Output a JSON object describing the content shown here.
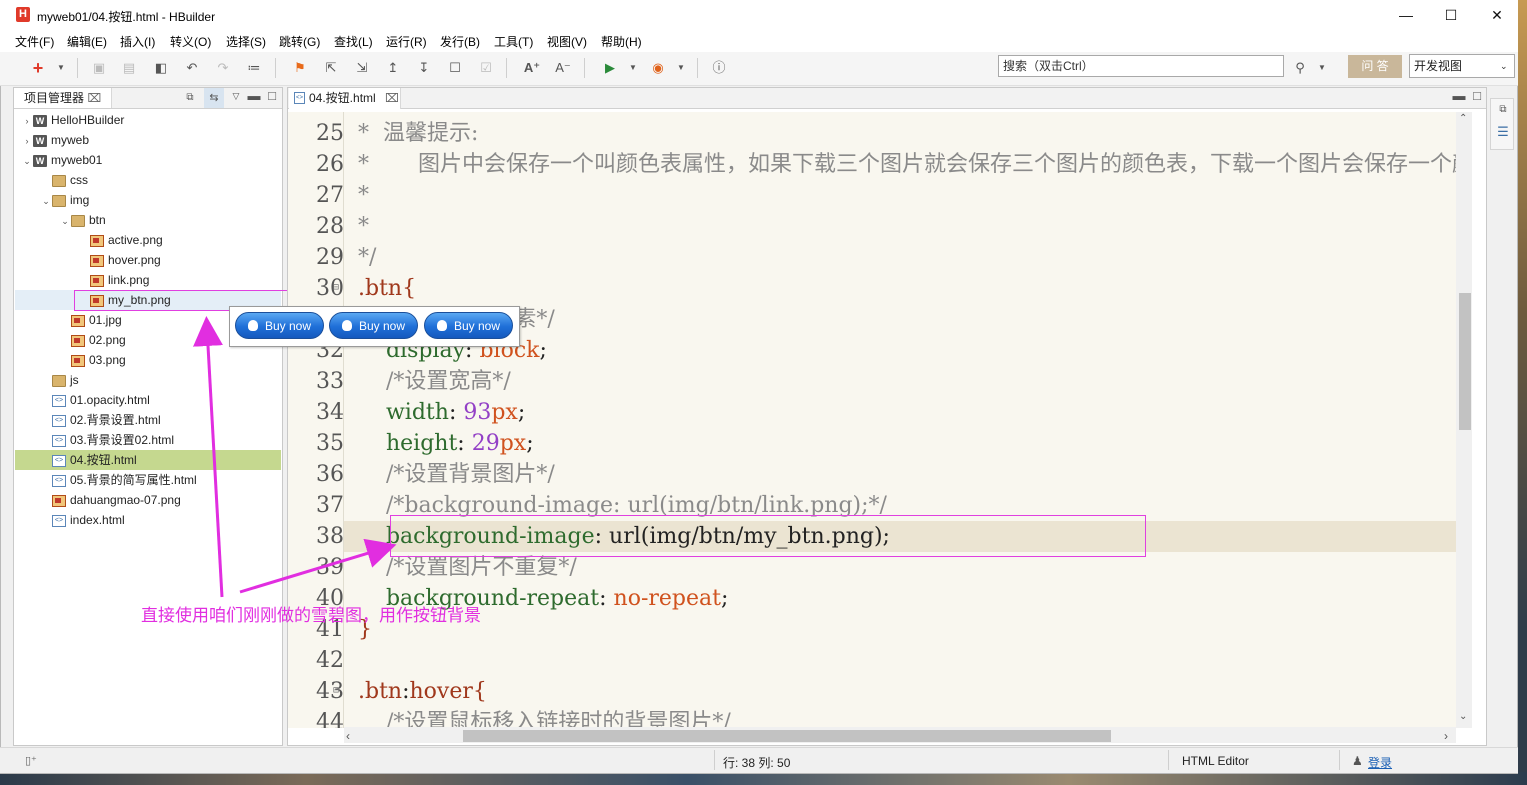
{
  "window": {
    "title": "myweb01/04.按钮.html  -  HBuilder",
    "app_icon": "H"
  },
  "menu": [
    "文件(F)",
    "编辑(E)",
    "插入(I)",
    "转义(O)",
    "选择(S)",
    "跳转(G)",
    "查找(L)",
    "运行(R)",
    "发行(B)",
    "工具(T)",
    "视图(V)",
    "帮助(H)"
  ],
  "toolbar": {
    "search_placeholder": "搜索（双击Ctrl）",
    "qa_label": "问 答",
    "view_select": "开发视图"
  },
  "project_panel": {
    "tab_label": "项目管理器",
    "tree": [
      {
        "label": "HelloHBuilder",
        "type": "project",
        "depth": 0,
        "toggle": "›"
      },
      {
        "label": "myweb",
        "type": "project",
        "depth": 0,
        "toggle": "›"
      },
      {
        "label": "myweb01",
        "type": "project",
        "depth": 0,
        "toggle": "⌄"
      },
      {
        "label": "css",
        "type": "folder",
        "depth": 1,
        "toggle": ""
      },
      {
        "label": "img",
        "type": "folder",
        "depth": 1,
        "toggle": "⌄"
      },
      {
        "label": "btn",
        "type": "folder",
        "depth": 2,
        "toggle": "⌄"
      },
      {
        "label": "active.png",
        "type": "png",
        "depth": 3,
        "toggle": ""
      },
      {
        "label": "hover.png",
        "type": "png",
        "depth": 3,
        "toggle": ""
      },
      {
        "label": "link.png",
        "type": "png",
        "depth": 3,
        "toggle": ""
      },
      {
        "label": "my_btn.png",
        "type": "png",
        "depth": 3,
        "toggle": "",
        "state": "hover"
      },
      {
        "label": "01.jpg",
        "type": "png",
        "depth": 2,
        "toggle": ""
      },
      {
        "label": "02.png",
        "type": "png",
        "depth": 2,
        "toggle": ""
      },
      {
        "label": "03.png",
        "type": "png",
        "depth": 2,
        "toggle": ""
      },
      {
        "label": "js",
        "type": "folder",
        "depth": 1,
        "toggle": ""
      },
      {
        "label": "01.opacity.html",
        "type": "html",
        "depth": 1,
        "toggle": ""
      },
      {
        "label": "02.背景设置.html",
        "type": "html",
        "depth": 1,
        "toggle": ""
      },
      {
        "label": "03.背景设置02.html",
        "type": "html",
        "depth": 1,
        "toggle": ""
      },
      {
        "label": "04.按钮.html",
        "type": "html",
        "depth": 1,
        "toggle": "",
        "state": "selected"
      },
      {
        "label": "05.背景的简写属性.html",
        "type": "html",
        "depth": 1,
        "toggle": ""
      },
      {
        "label": "dahuangmao-07.png",
        "type": "png",
        "depth": 1,
        "toggle": ""
      },
      {
        "label": "index.html",
        "type": "html",
        "depth": 1,
        "toggle": ""
      }
    ]
  },
  "editor": {
    "tab_label": "04.按钮.html",
    "lines": [
      {
        "n": "25",
        "fold": "",
        "parts": [
          [
            "c-com",
            "*  温馨提示:"
          ]
        ]
      },
      {
        "n": "26",
        "fold": "",
        "parts": [
          [
            "c-com",
            "*       图片中会保存一个叫颜色表属性，如果下载三个图片就会保存三个图片的颜色表，下载一个图片会保存一个颜色表"
          ]
        ]
      },
      {
        "n": "27",
        "fold": "",
        "parts": [
          [
            "c-com",
            "*"
          ]
        ]
      },
      {
        "n": "28",
        "fold": "",
        "parts": [
          [
            "c-com",
            "*"
          ]
        ]
      },
      {
        "n": "29",
        "fold": "",
        "parts": [
          [
            "c-com",
            "*/"
          ]
        ]
      },
      {
        "n": "30",
        "fold": "⊟",
        "parts": [
          [
            "c-sel",
            ".btn{"
          ]
        ]
      },
      {
        "n": "31",
        "fold": "",
        "parts": [
          [
            "c-com",
            "    /*转换为块元素*/"
          ]
        ]
      },
      {
        "n": "32",
        "fold": "",
        "parts": [
          [
            "c-prop",
            "    display"
          ],
          [
            "c-punc",
            ": "
          ],
          [
            "c-val",
            "block"
          ],
          [
            "c-punc",
            ";"
          ]
        ]
      },
      {
        "n": "33",
        "fold": "",
        "parts": [
          [
            "c-com",
            "    /*设置宽高*/"
          ]
        ]
      },
      {
        "n": "34",
        "fold": "",
        "parts": [
          [
            "c-prop",
            "    width"
          ],
          [
            "c-punc",
            ": "
          ],
          [
            "c-num",
            "93"
          ],
          [
            "c-val",
            "px"
          ],
          [
            "c-punc",
            ";"
          ]
        ]
      },
      {
        "n": "35",
        "fold": "",
        "parts": [
          [
            "c-prop",
            "    height"
          ],
          [
            "c-punc",
            ": "
          ],
          [
            "c-num",
            "29"
          ],
          [
            "c-val",
            "px"
          ],
          [
            "c-punc",
            ";"
          ]
        ]
      },
      {
        "n": "36",
        "fold": "",
        "parts": [
          [
            "c-com",
            "    /*设置背景图片*/"
          ]
        ]
      },
      {
        "n": "37",
        "fold": "",
        "parts": [
          [
            "c-com",
            "    /*background-image: url(img/btn/link.png);*/"
          ]
        ]
      },
      {
        "n": "38",
        "fold": "",
        "parts": [
          [
            "c-prop",
            "    background-image"
          ],
          [
            "c-punc",
            ": "
          ],
          [
            "c-def",
            "url(img/btn/my_btn.png);"
          ]
        ]
      },
      {
        "n": "39",
        "fold": "",
        "parts": [
          [
            "c-com",
            "    /*设置图片不重复*/"
          ]
        ]
      },
      {
        "n": "40",
        "fold": "",
        "parts": [
          [
            "c-prop",
            "    background-repeat"
          ],
          [
            "c-punc",
            ": "
          ],
          [
            "c-val",
            "no-repeat"
          ],
          [
            "c-punc",
            ";"
          ]
        ]
      },
      {
        "n": "41",
        "fold": "",
        "parts": [
          [
            "c-sel",
            "}"
          ]
        ]
      },
      {
        "n": "42",
        "fold": "",
        "parts": []
      },
      {
        "n": "43",
        "fold": "⊟",
        "parts": [
          [
            "c-sel",
            ".btn"
          ],
          [
            "c-punc",
            ":"
          ],
          [
            "c-sel",
            "hover{"
          ]
        ]
      },
      {
        "n": "44",
        "fold": "",
        "parts": [
          [
            "c-com",
            "    /*设置鼠标移入链接时的背景图片*/"
          ]
        ]
      }
    ]
  },
  "preview_popup": {
    "buttons": [
      "Buy now",
      "Buy now",
      "Buy now"
    ]
  },
  "annotation": {
    "text": "直接使用咱们刚刚做的雪碧图，用作按钮背景",
    "color": "#e12ee0"
  },
  "status_bar": {
    "position": "行: 38 列: 50",
    "editor_type": "HTML Editor",
    "login": "登录"
  }
}
